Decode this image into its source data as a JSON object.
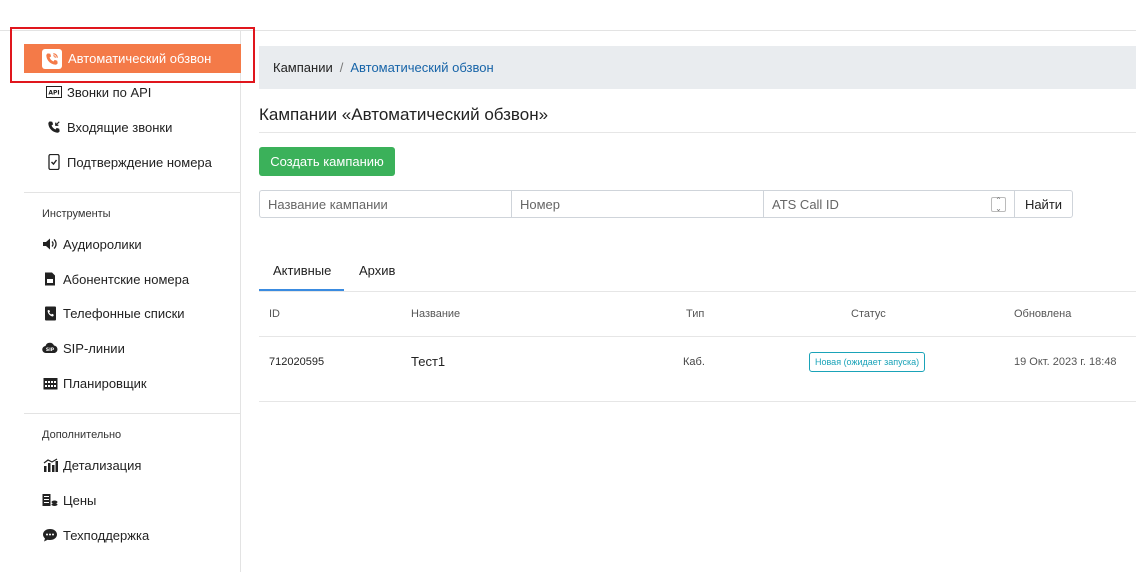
{
  "sidebar": {
    "main_items": [
      {
        "label": "Автоматический обзвон",
        "icon": "phone-call-icon",
        "active": true
      },
      {
        "label": "Звонки по API",
        "icon": "api-icon"
      },
      {
        "label": "Входящие звонки",
        "icon": "incoming-call-icon"
      },
      {
        "label": "Подтверждение номера",
        "icon": "phone-check-icon"
      }
    ],
    "tools_title": "Инструменты",
    "tools_items": [
      {
        "label": "Аудиоролики",
        "icon": "speaker-icon"
      },
      {
        "label": "Абонентские номера",
        "icon": "sim-card-icon"
      },
      {
        "label": "Телефонные списки",
        "icon": "phone-book-icon"
      },
      {
        "label": "SIP-линии",
        "icon": "sip-cloud-icon"
      },
      {
        "label": "Планировщик",
        "icon": "calendar-icon"
      }
    ],
    "extra_title": "Дополнительно",
    "extra_items": [
      {
        "label": "Детализация",
        "icon": "chart-icon"
      },
      {
        "label": "Цены",
        "icon": "money-icon"
      },
      {
        "label": "Техподдержка",
        "icon": "chat-icon"
      }
    ]
  },
  "breadcrumb": {
    "root": "Кампании",
    "separator": "/",
    "current": "Автоматический обзвон"
  },
  "page_title": "Кампании «Автоматический обзвон»",
  "create_button": "Создать кампанию",
  "filters": {
    "name_placeholder": "Название кампании",
    "number_placeholder": "Номер",
    "ats_placeholder": "ATS Call ID",
    "find_button": "Найти"
  },
  "tabs": [
    {
      "label": "Активные",
      "active": true
    },
    {
      "label": "Архив",
      "active": false
    }
  ],
  "table": {
    "headers": [
      "ID",
      "Название",
      "Тип",
      "Статус",
      "Обновлена"
    ],
    "rows": [
      {
        "id": "712020595",
        "name": "Тест1",
        "type": "Каб.",
        "status": "Новая (ожидает запуска)",
        "updated": "19 Окт. 2023 г. 18:48"
      }
    ]
  },
  "colors": {
    "accent": "#f47a48",
    "success": "#3bb15a",
    "link": "#1764a8",
    "badge": "#1aa3b8",
    "highlight": "#e0161d"
  }
}
